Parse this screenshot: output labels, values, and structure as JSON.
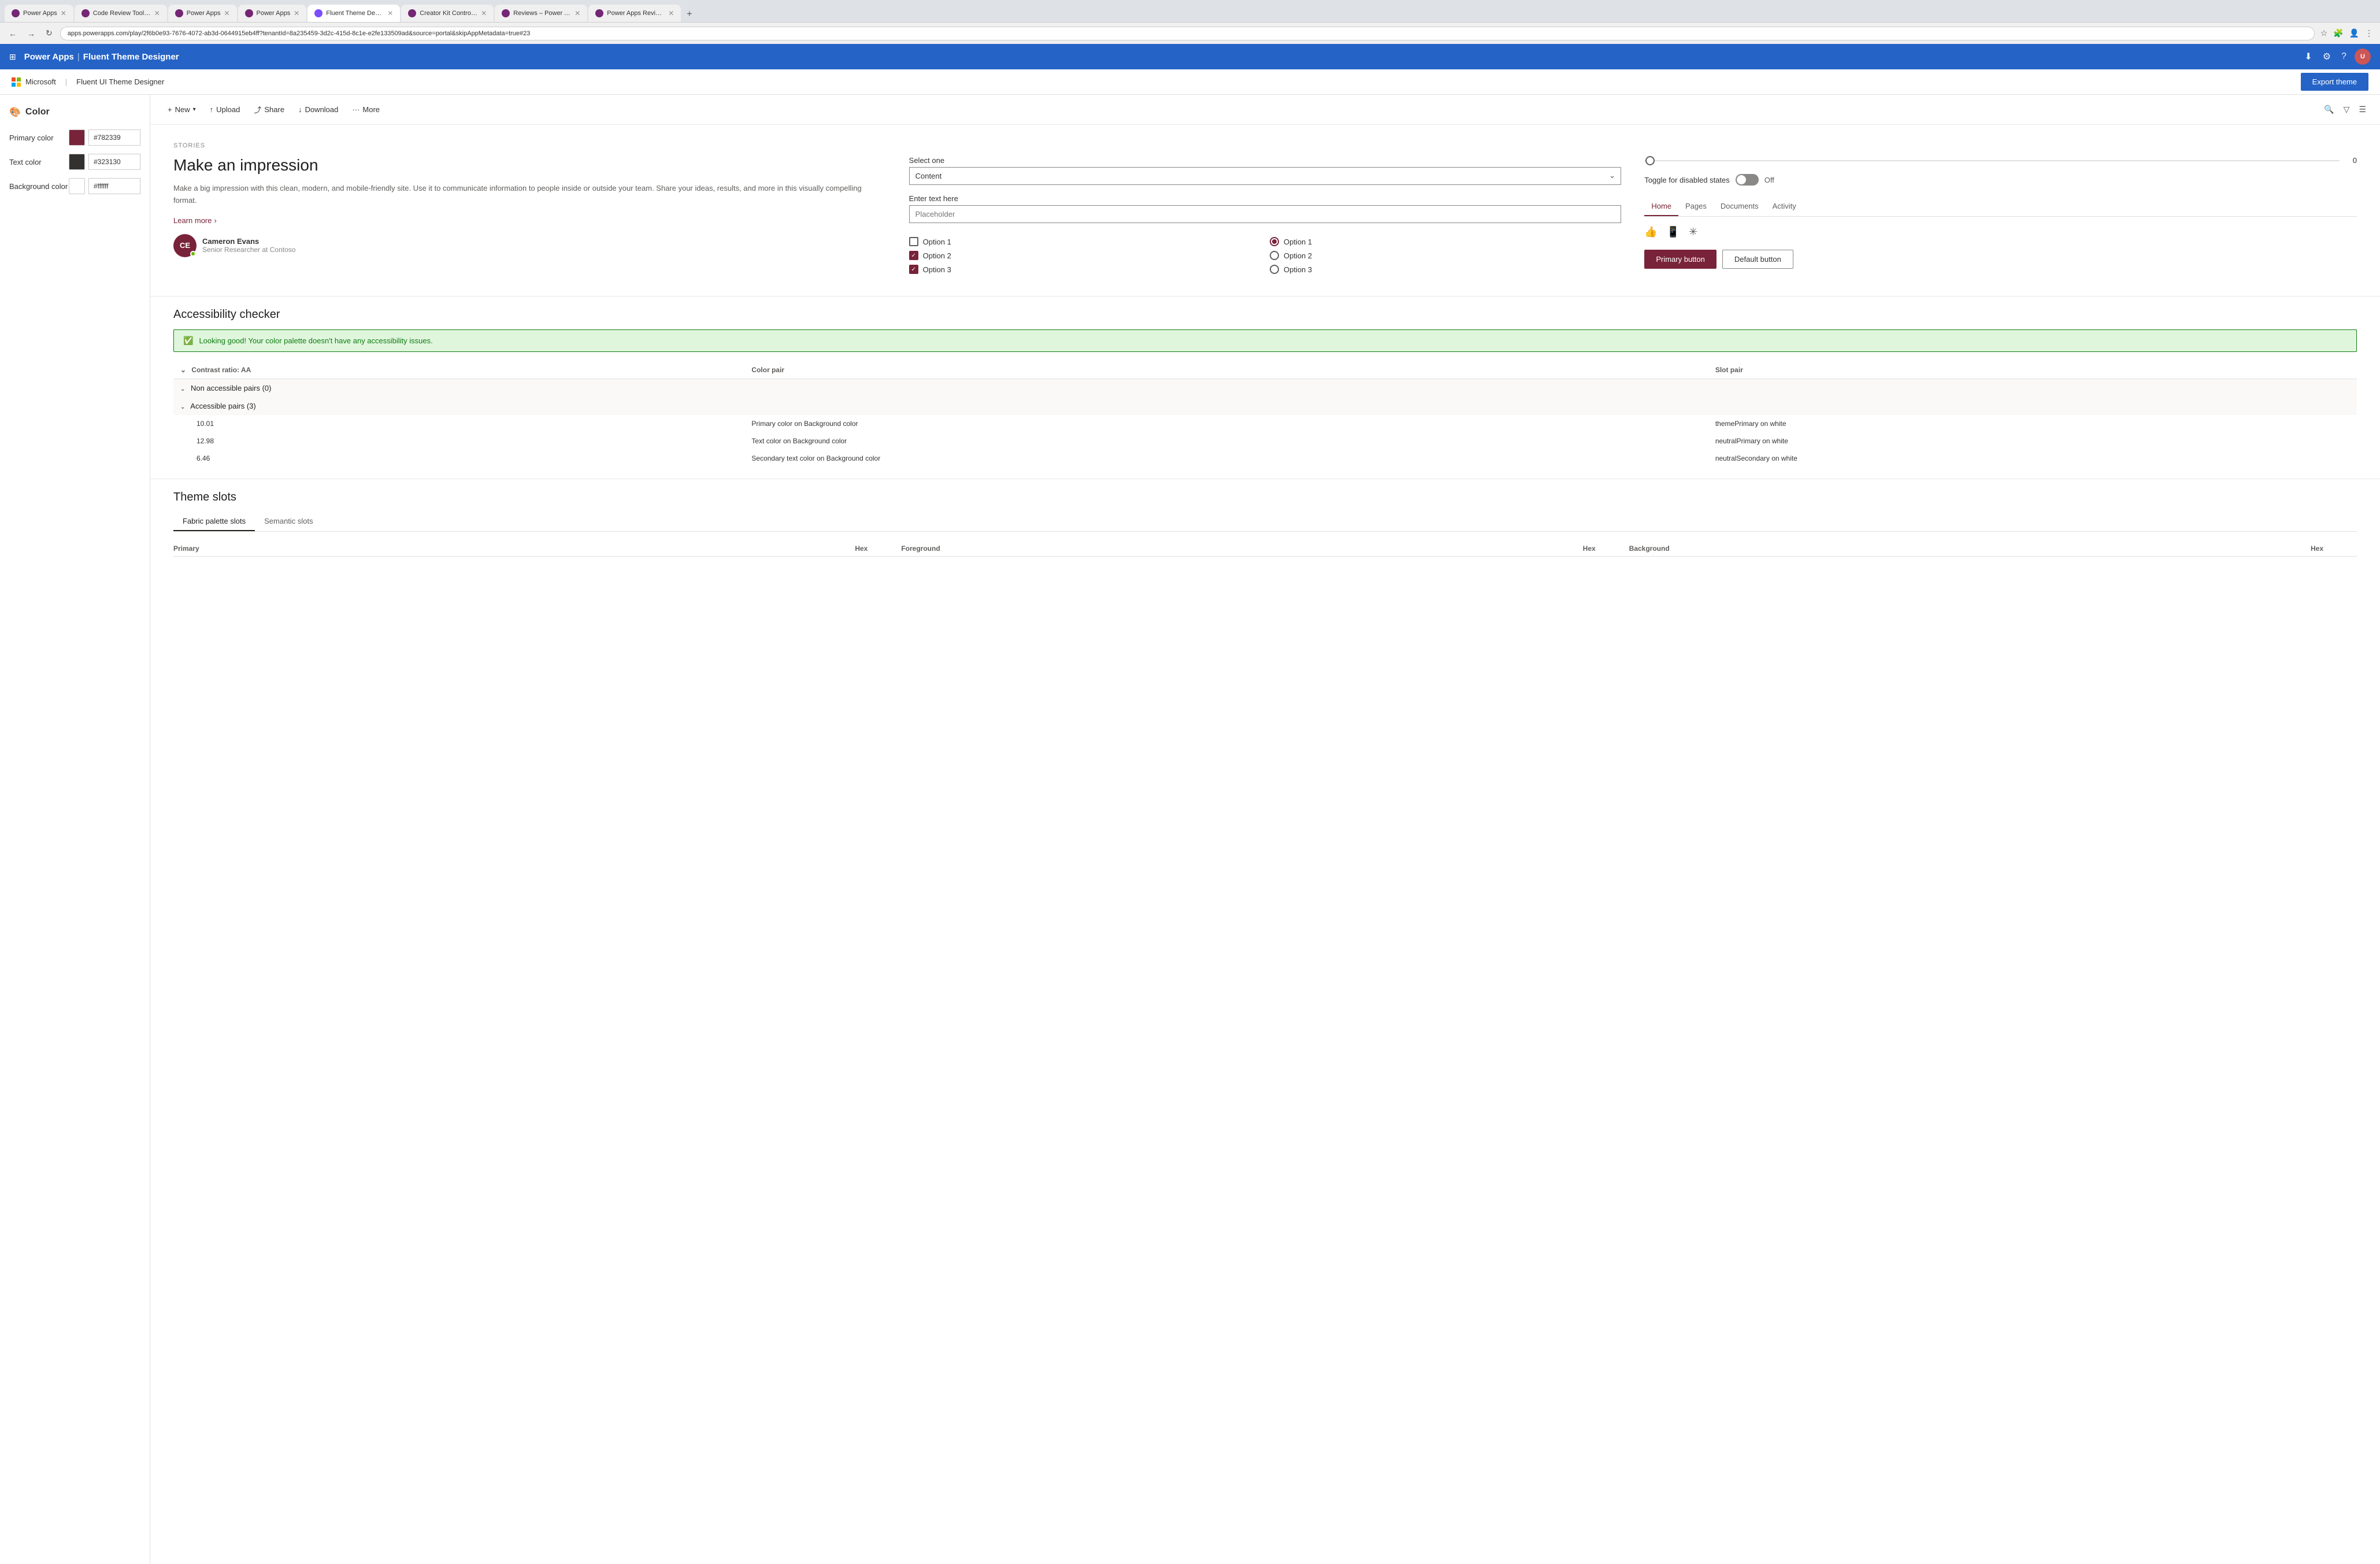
{
  "browser": {
    "tabs": [
      {
        "id": "tab1",
        "label": "Power Apps",
        "active": false,
        "icon_color": "#742774"
      },
      {
        "id": "tab2",
        "label": "Code Review Tool Experim...",
        "active": false,
        "icon_color": "#742774"
      },
      {
        "id": "tab3",
        "label": "Power Apps",
        "active": false,
        "icon_color": "#742774"
      },
      {
        "id": "tab4",
        "label": "Power Apps",
        "active": false,
        "icon_color": "#742774"
      },
      {
        "id": "tab5",
        "label": "Fluent Theme Designer -",
        "active": true,
        "icon_color": "#7c4dff"
      },
      {
        "id": "tab6",
        "label": "Creator Kit Control Refere...",
        "active": false,
        "icon_color": "#742774"
      },
      {
        "id": "tab7",
        "label": "Reviews – Power Apps",
        "active": false,
        "icon_color": "#742774"
      },
      {
        "id": "tab8",
        "label": "Power Apps Review Tool –",
        "active": false,
        "icon_color": "#742774"
      }
    ],
    "address": "apps.powerapps.com/play/2f6b0e93-7676-4072-ab3d-0644915eb4ff?tenantId=8a235459-3d2c-415d-8c1e-e2fe133509ad&source=portal&skipAppMetadata=true#23",
    "new_tab_label": "+"
  },
  "app_header": {
    "title": "Power Apps",
    "separator": "|",
    "subtitle": "Fluent Theme Designer",
    "waffle_icon": "⊞",
    "avatar_initials": "U",
    "icons": [
      "⬇",
      "⚙",
      "?"
    ]
  },
  "sub_header": {
    "ms_label": "Microsoft",
    "separator": "|",
    "app_label": "Fluent UI Theme Designer",
    "export_btn": "Export theme"
  },
  "sidebar": {
    "section_title": "Color",
    "section_icon": "🎨",
    "colors": [
      {
        "label": "Primary color",
        "hex": "#782339",
        "input_value": "#782339"
      },
      {
        "label": "Text color",
        "hex": "#323130",
        "input_value": "#323130"
      },
      {
        "label": "Background color",
        "hex": "#ffffff",
        "input_value": "#ffffff"
      }
    ]
  },
  "toolbar": {
    "new_label": "New",
    "upload_label": "Upload",
    "share_label": "Share",
    "download_label": "Download",
    "more_label": "More"
  },
  "demo": {
    "stories_label": "STORIES",
    "headline": "Make an impression",
    "body_text": "Make a big impression with this clean, modern, and mobile-friendly site. Use it to communicate information to people inside or outside your team. Share your ideas, results, and more in this visually compelling format.",
    "learn_more": "Learn more",
    "avatar": {
      "initials": "CE",
      "name": "Cameron Evans",
      "title": "Senior Researcher at Contoso"
    },
    "form": {
      "select_label": "Select one",
      "select_value": "Content",
      "input_label": "Enter text here",
      "input_placeholder": "Placeholder",
      "checkboxes": [
        {
          "label": "Option 1",
          "checked": false
        },
        {
          "label": "Option 2",
          "checked": true
        },
        {
          "label": "Option 3",
          "checked": true
        }
      ],
      "radios": [
        {
          "label": "Option 1",
          "checked": true
        },
        {
          "label": "Option 2",
          "checked": false
        },
        {
          "label": "Option 3",
          "checked": false
        }
      ]
    },
    "controls": {
      "slider_value": "0",
      "toggle_label": "Toggle for disabled states",
      "toggle_state": "Off",
      "nav_tabs": [
        "Home",
        "Pages",
        "Documents",
        "Activity"
      ],
      "active_tab": "Home",
      "icons": [
        "👍",
        "📱",
        "✳"
      ],
      "primary_btn": "Primary button",
      "default_btn": "Default button"
    }
  },
  "accessibility": {
    "title": "Accessibility checker",
    "success_msg": "Looking good! Your color palette doesn't have any accessibility issues.",
    "table_headers": [
      "Contrast ratio: AA",
      "Color pair",
      "Slot pair"
    ],
    "non_accessible": {
      "label": "Non accessible pairs (0)"
    },
    "accessible": {
      "label": "Accessible pairs (3)",
      "rows": [
        {
          "ratio": "10.01",
          "color_pair": "Primary color on Background color",
          "slot_pair": "themePrimary on white"
        },
        {
          "ratio": "12.98",
          "color_pair": "Text color on Background color",
          "slot_pair": "neutralPrimary on white"
        },
        {
          "ratio": "6.46",
          "color_pair": "Secondary text color on Background color",
          "slot_pair": "neutralSecondary on white"
        }
      ]
    }
  },
  "theme_slots": {
    "title": "Theme slots",
    "tabs": [
      "Fabric palette slots",
      "Semantic slots"
    ],
    "active_tab": "Fabric palette slots",
    "table_headers": [
      "Primary",
      "Hex",
      "Foreground",
      "Hex",
      "Background",
      "Hex"
    ]
  }
}
